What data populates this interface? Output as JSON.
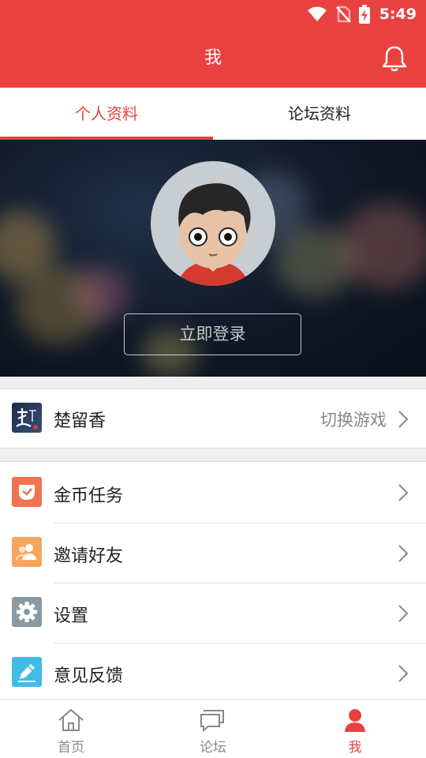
{
  "status_bar": {
    "time": "5:49",
    "icons": [
      "wifi-icon",
      "no-sim-icon",
      "battery-charging-icon"
    ]
  },
  "app_bar": {
    "title": "我",
    "action_icon": "bell-icon"
  },
  "tabs": [
    {
      "label": "个人资料",
      "active": true
    },
    {
      "label": "论坛资料",
      "active": false
    }
  ],
  "profile": {
    "login_label": "立即登录",
    "avatar_icon": "cartoon-boy-avatar"
  },
  "game_row": {
    "name": "楚留香",
    "action": "切换游戏",
    "icon": "chuliuxiang-game-icon"
  },
  "menu": [
    {
      "label": "金币任务",
      "icon": "coin-task-icon",
      "color": "#ef7451"
    },
    {
      "label": "邀请好友",
      "icon": "invite-friends-icon",
      "color": "#f6a55e"
    },
    {
      "label": "设置",
      "icon": "settings-gear-icon",
      "color": "#8c9aa3"
    },
    {
      "label": "意见反馈",
      "icon": "feedback-pencil-icon",
      "color": "#3fbde6"
    }
  ],
  "bottom_nav": [
    {
      "label": "首页",
      "icon": "home-icon",
      "active": false
    },
    {
      "label": "论坛",
      "icon": "forum-chat-icon",
      "active": false
    },
    {
      "label": "我",
      "icon": "user-icon",
      "active": true
    }
  ],
  "colors": {
    "accent": "#e94140",
    "muted": "#8a8a8a"
  }
}
